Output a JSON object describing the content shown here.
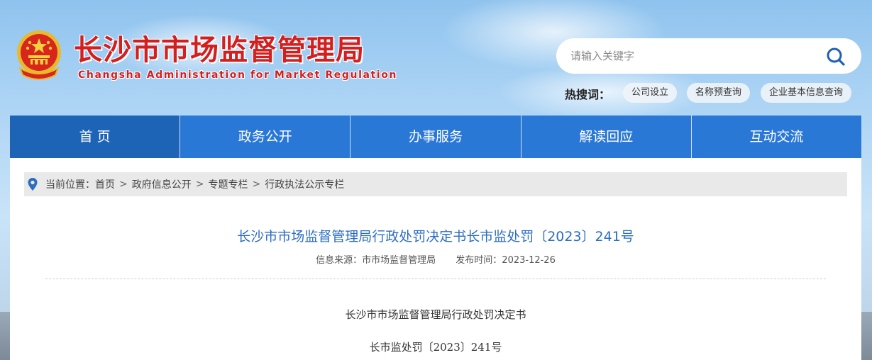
{
  "site": {
    "title": "长沙市市场监督管理局",
    "subtitle": "Changsha Administration for Market Regulation"
  },
  "search": {
    "placeholder": "请输入关键字",
    "hot_label": "热搜词：",
    "hot_tags": [
      "公司设立",
      "名称预查询",
      "企业基本信息查询"
    ]
  },
  "nav": {
    "items": [
      "首 页",
      "政务公开",
      "办事服务",
      "解读回应",
      "互动交流"
    ]
  },
  "breadcrumb": {
    "prefix": "当前位置：",
    "items": [
      "首页",
      "政府信息公开",
      "专题专栏",
      "行政执法公示专栏"
    ],
    "separator": ">"
  },
  "article": {
    "title": "长沙市市场监督管理局行政处罚决定书长市监处罚〔2023〕241号",
    "source": "信息来源：市市场监督管理局",
    "date": "发布时间：2023-12-26",
    "body": [
      "长沙市市场监督管理局行政处罚决定书",
      "长市监处罚〔2023〕241号"
    ]
  },
  "colors": {
    "brand_red": "#d21f1f",
    "nav_blue": "#2a78d6",
    "nav_active": "#1d63b6",
    "title_blue": "#2a6cc2"
  }
}
